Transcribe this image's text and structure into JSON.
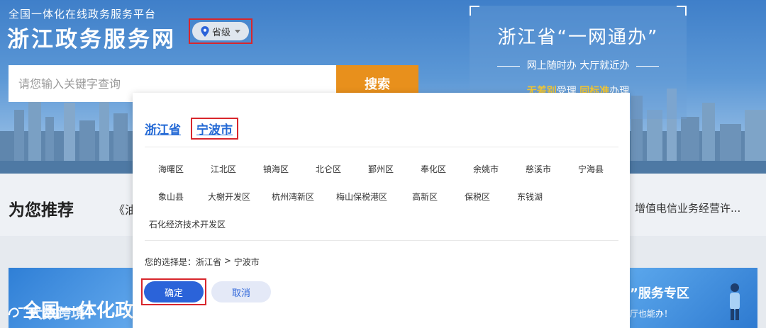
{
  "header": {
    "platform_subtitle": "全国一体化在线政务服务平台",
    "site_title": "浙江政务服务网",
    "region_selector": {
      "label": "省级",
      "icon": "location-pin-icon"
    },
    "search": {
      "placeholder": "请您输入关键字查询",
      "button_label": "搜索"
    }
  },
  "promo": {
    "title": "浙江省“一网通办”",
    "subtitle": "网上随时办 大厅就近办",
    "line_part1": "无差别",
    "line_part2": "受理",
    "line_part3": "同标准",
    "line_part4": "办理",
    "highlight_color": "#f3c630"
  },
  "recommend": {
    "title": "为您推荐",
    "left_item": "《油",
    "right_item": "增值电信业务经营许..."
  },
  "cards": {
    "left_text": "全国一体化政",
    "right_text": "”服务专区",
    "right_sub": "厅也能办！"
  },
  "watermark": {
    "text": "大数跨境"
  },
  "modal": {
    "breadcrumb": {
      "province": "浙江省",
      "separator": "›",
      "city": "宁波市"
    },
    "regions_row1": [
      "海曙区",
      "江北区",
      "镇海区",
      "北仑区",
      "鄞州区",
      "奉化区",
      "余姚市",
      "慈溪市",
      "宁海县"
    ],
    "regions_row2": [
      "象山县",
      "大榭开发区",
      "杭州湾新区",
      "梅山保税港区",
      "高新区",
      "保税区",
      "东钱湖"
    ],
    "regions_row3": [
      "石化经济技术开发区"
    ],
    "selection": {
      "prefix": "您的选择是：",
      "province": "浙江省",
      "arrow": " > ",
      "city": "宁波市"
    },
    "confirm_label": "确定",
    "cancel_label": "取消",
    "colors": {
      "primary": "#2b63d9",
      "highlight_border": "#d8262c",
      "search_button": "#e8901c"
    }
  }
}
